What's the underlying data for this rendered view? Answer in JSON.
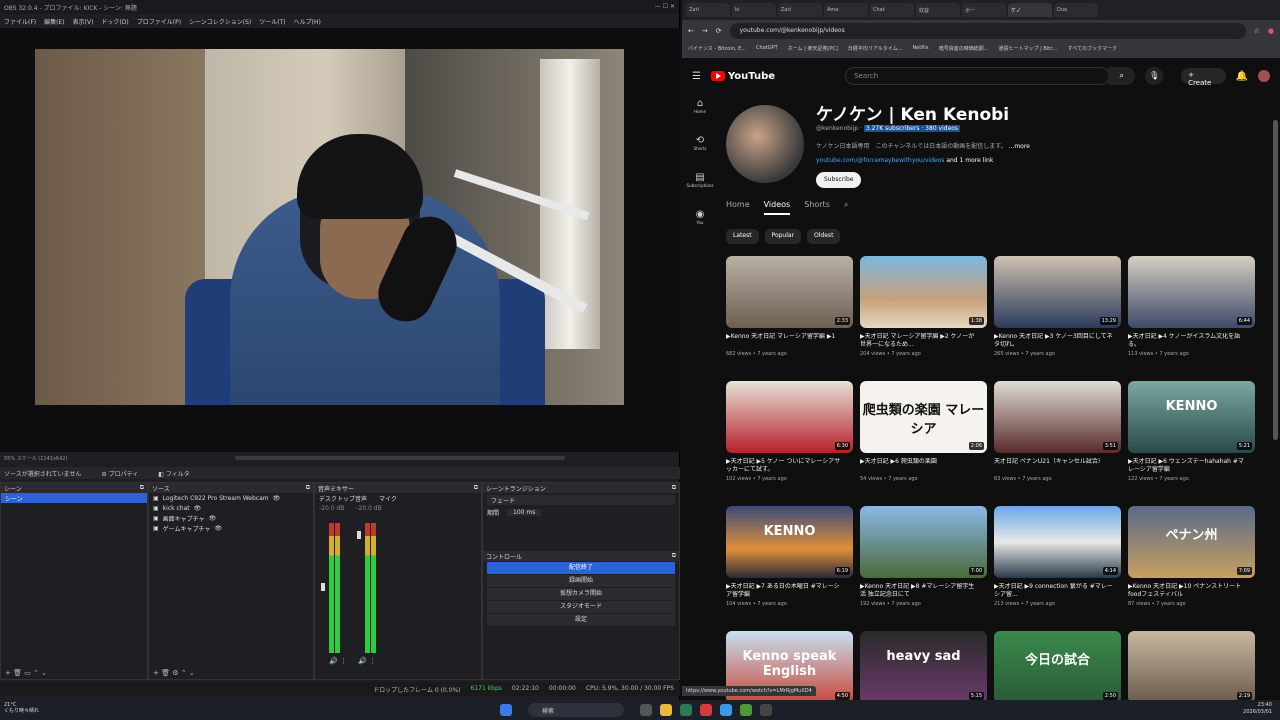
{
  "obs": {
    "title": "OBS 32.0.4 - プロファイル: KICK - シーン: 無題",
    "menu": [
      "ファイル(F)",
      "編集(E)",
      "表示(V)",
      "ドック(D)",
      "プロファイル(P)",
      "シーンコレクション(S)",
      "ツール(T)",
      "ヘルプ(H)"
    ],
    "scale_label": "55% スケール (1141x642)",
    "source_status": "ソースが選択されていません",
    "properties_label": "プロパティ",
    "filter_label": "フィルタ",
    "scenes_title": "シーン",
    "scene_item": "シーン",
    "sources_title": "ソース",
    "sources": [
      "Logitech C922 Pro Stream Webcam",
      "kick chat",
      "画面キャプチャ",
      "ゲームキャプチャ"
    ],
    "mixer_title": "音声ミキサー",
    "mixer_ch1": "デスクトップ音声",
    "mixer_ch2": "マイク",
    "mixer_db1": "-20.0 dB",
    "mixer_db2": "-20.0 dB",
    "transition_title": "シーントランジション",
    "transition_value": "フェード",
    "duration_label": "期間",
    "duration_value": "100 ms",
    "controls_title": "コントロール",
    "controls": [
      "配信終了",
      "録画開始",
      "仮想カメラ開始",
      "スタジオモード",
      "設定"
    ],
    "status": {
      "dropped": "ドロップしたフレーム 0 (0.0%)",
      "bitrate": "6171 kbps",
      "live_time": "02:22:10",
      "rec_time": "00:00:00",
      "cpu": "CPU: 5.9%, 30.00 / 30.00 FPS"
    }
  },
  "browser": {
    "tabs": [
      "Zati",
      "ki",
      "Zati",
      "Ama",
      "Chat",
      "収益",
      "ボー",
      "ケノ",
      "Duo"
    ],
    "url": "youtube.com/@kenkenobijp/videos",
    "bookmarks": [
      "バイナンス - Bitcoin, E...",
      "ChatGPT",
      "ホーム | 楽天証券[PC]",
      "日経平均リアルタイム...",
      "Netflix",
      "暗号資産の時価総額...",
      "通貨ヒートマップ | Bitc...",
      "すべてのブックマーク"
    ],
    "hover_url": "https://www.youtube.com/watch?v=LMrRjgMuXD4"
  },
  "youtube": {
    "logo": "YouTube",
    "search_placeholder": "Search",
    "create": "Create",
    "rail": [
      {
        "icon": "⌂",
        "label": "Home"
      },
      {
        "icon": "⟲",
        "label": "Shorts"
      },
      {
        "icon": "▤",
        "label": "Subscriptions"
      },
      {
        "icon": "◉",
        "label": "You"
      }
    ],
    "channel_name": "ケノケン | Ken Kenobi",
    "handle": "@kenkenobijp",
    "subs": "3.27K subscribers · 380 videos",
    "description": "ケノケン日本語専用　このチャンネルでは日本語の動画を配信します。",
    "more": "...more",
    "link": "youtube.com/@forcemaybewithyou/videos",
    "more_links": "and 1 more link",
    "subscribe": "Subscribe",
    "tabs": [
      "Home",
      "Videos",
      "Shorts"
    ],
    "chips": [
      "Latest",
      "Popular",
      "Oldest"
    ],
    "videos": [
      {
        "title": "▶Kenno 天才日記 マレーシア留学編 ▶1",
        "meta": "682 views • 7 years ago",
        "dur": "2:33",
        "bg": "linear-gradient(#b9b0a4,#6d5f52)"
      },
      {
        "title": "▶天才日記 マレーシア留学編 ▶2 ケノーが世界一になるため...",
        "meta": "204 views • 7 years ago",
        "dur": "1:38",
        "bg": "linear-gradient(#7ab8e0,#c8a07a 60%,#e6d8c0)"
      },
      {
        "title": "▶Kenno 天才日記 ▶3 ケノー3回目にしてネタ切れ。",
        "meta": "265 views • 7 years ago",
        "dur": "13:29",
        "bg": "linear-gradient(#cfc2b0,#2b3a5c)"
      },
      {
        "title": "▶天才日記 ▶4 ケノーがイスラム文化を語る。",
        "meta": "113 views • 7 years ago",
        "dur": "6:44",
        "bg": "linear-gradient(#d6cfc2,#3d4a6a)"
      },
      {
        "title": "▶天才日記 ▶5 ケノー ついにマレーシアサッカーにて試す。",
        "meta": "102 views • 7 years ago",
        "dur": "6:30",
        "bg": "linear-gradient(#e8e2d8,#b5202a)"
      },
      {
        "title": "▶天才日記 ▶6 爬虫類の楽園",
        "meta": "54 views • 7 years ago",
        "dur": "2:06",
        "bg": "#f6f3ee",
        "text": "爬虫類の楽園 マレーシア"
      },
      {
        "title": "天才日記 ペナンU21（キャンセル試合）",
        "meta": "63 views • 7 years ago",
        "dur": "3:51",
        "bg": "linear-gradient(#e0dcd6,#5a2a2a)"
      },
      {
        "title": "▶天才日記 ▶6 ウェンズデーhahahah #マレーシア留学編",
        "meta": "122 views • 7 years ago",
        "dur": "5:21",
        "bg": "linear-gradient(#7aa8a0,#2a4a4a)",
        "text": "KENNO"
      },
      {
        "title": "▶天才日記 ▶7 ある日の木曜日 #マレーシア留学編",
        "meta": "104 views • 7 years ago",
        "dur": "6:19",
        "bg": "linear-gradient(#3a4a7a,#e0903a 60%,#2a2a3a)",
        "text": "KENNO"
      },
      {
        "title": "▶Kenno 天才日記 ▶8 #マレーシア留学生活 独立記念日にて",
        "meta": "192 views • 7 years ago",
        "dur": "7:00",
        "bg": "linear-gradient(#8ab8e8,#4a6a3a)"
      },
      {
        "title": "▶天才日記 ▶9 connection 繋がる #マレーシア留...",
        "meta": "213 views • 7 years ago",
        "dur": "4:14",
        "bg": "linear-gradient(#6aa8e8,#e8e8e8 50%,#2a3a4a)"
      },
      {
        "title": "▶Kenno 天才日記 ▶10 ペナンストリートfoodフェスティバル",
        "meta": "87 views • 7 years ago",
        "dur": "7:09",
        "bg": "linear-gradient(#5a6a8a,#c8a060)",
        "text": "ペナン州"
      },
      {
        "title": "",
        "meta": "",
        "dur": "4:50",
        "bg": "linear-gradient(#c8e0f0,#c8483a)",
        "text": "Kenno speak English"
      },
      {
        "title": "",
        "meta": "",
        "dur": "5:15",
        "bg": "linear-gradient(#2a2a2a,#6a3a6a)",
        "text": "heavy sad"
      },
      {
        "title": "",
        "meta": "",
        "dur": "2:50",
        "bg": "linear-gradient(#3a8a4a,#2a5a3a)",
        "text": "今日の試合"
      },
      {
        "title": "",
        "meta": "",
        "dur": "2:19",
        "bg": "linear-gradient(#c8b8a0,#6a5a4a)"
      }
    ]
  },
  "taskbar": {
    "temp": "21°C",
    "weather": "くもり時々晴れ",
    "search": "検索",
    "time": "23:40",
    "date": "2026/03/01"
  }
}
